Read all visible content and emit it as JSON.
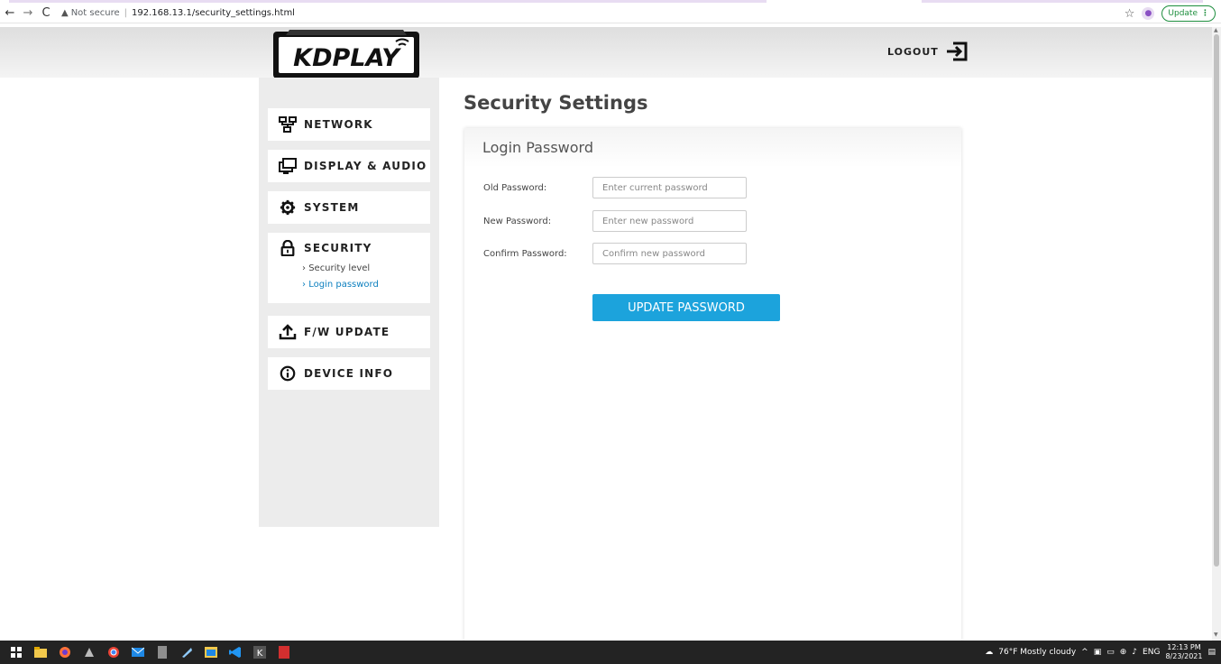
{
  "browser": {
    "url_warning": "Not secure",
    "url": "192.168.13.1/security_settings.html",
    "update_label": "Update"
  },
  "header": {
    "logo_text": "KDPLAY",
    "logout_label": "LOGOUT"
  },
  "sidebar": {
    "items": [
      {
        "label": "NETWORK",
        "icon": "network-icon"
      },
      {
        "label": "DISPLAY & AUDIO",
        "icon": "display-audio-icon"
      },
      {
        "label": "SYSTEM",
        "icon": "gear-icon"
      },
      {
        "label": "SECURITY",
        "icon": "lock-icon"
      },
      {
        "label": "F/W UPDATE",
        "icon": "upload-icon"
      },
      {
        "label": "DEVICE INFO",
        "icon": "info-icon"
      }
    ],
    "security_sub": [
      {
        "label": "Security level"
      },
      {
        "label": "Login password"
      }
    ]
  },
  "main": {
    "title": "Security Settings",
    "panel_title": "Login Password",
    "fields": [
      {
        "label": "Old Password:",
        "placeholder": "Enter current password"
      },
      {
        "label": "New Password:",
        "placeholder": "Enter new password"
      },
      {
        "label": "Confirm Password:",
        "placeholder": "Confirm new password"
      }
    ],
    "submit_label": "UPDATE PASSWORD"
  },
  "taskbar": {
    "weather": "76°F  Mostly cloudy",
    "lang": "ENG",
    "time": "12:13 PM",
    "date": "8/23/2021"
  },
  "colors": {
    "accent": "#1ca3dc",
    "active_link": "#0b7fbf",
    "sidebar_bg": "#ececec"
  }
}
